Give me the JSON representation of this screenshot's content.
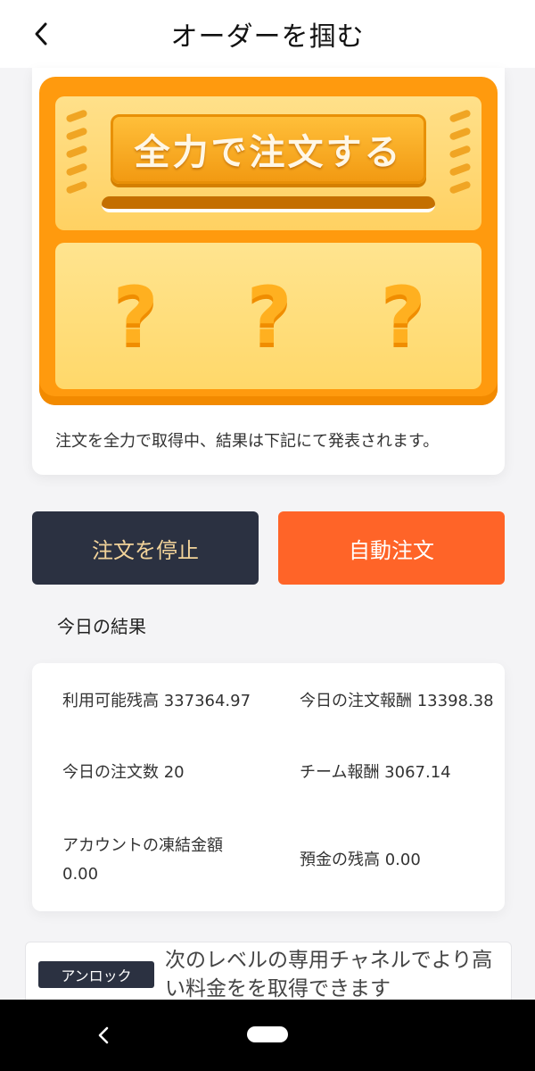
{
  "header": {
    "title": "オーダーを掴む",
    "back_icon": "chevron-left-icon"
  },
  "machine": {
    "play_label": "全力で注文する",
    "slots": [
      "?",
      "?",
      "?"
    ],
    "caption": "注文を全力で取得中、結果は下記にて発表されます。"
  },
  "actions": {
    "stop_label": "注文を停止",
    "auto_label": "自動注文"
  },
  "results": {
    "section_title": "今日の結果",
    "available_balance": "利用可能残高 337364.97",
    "order_commission": "今日の注文報酬 13398.38",
    "order_count": "今日の注文数 20",
    "team_commission": "チーム報酬 3067.14",
    "frozen_label": "アカウントの凍結金額",
    "frozen_value": "0.00",
    "deposit_balance": "預金の残高 0.00"
  },
  "unlock": {
    "badge": "アンロック",
    "text": "次のレベルの専用チャネルでより高い料金をを取得できます"
  },
  "colors": {
    "accent": "#ff6428",
    "dark_button": "#2b3141",
    "machine_orange": "#ff9a0e"
  }
}
